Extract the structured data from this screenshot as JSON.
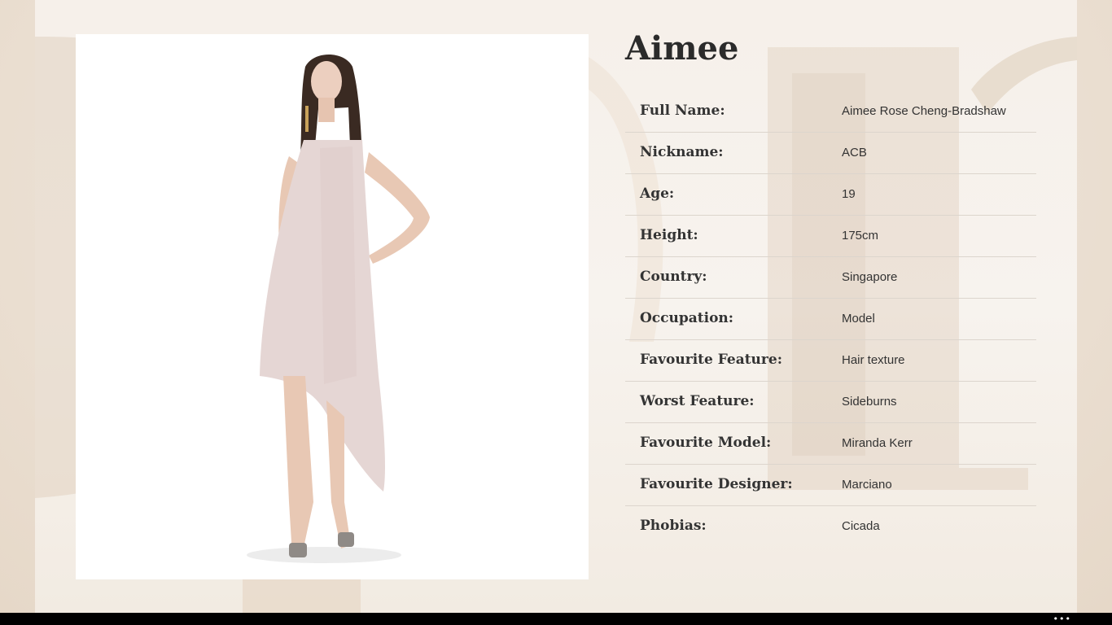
{
  "profile": {
    "name": "Aimee"
  },
  "details": [
    {
      "label": "Full Name:",
      "value": "Aimee Rose Cheng-Bradshaw"
    },
    {
      "label": "Nickname:",
      "value": "ACB"
    },
    {
      "label": "Age:",
      "value": "19"
    },
    {
      "label": "Height:",
      "value": "175cm"
    },
    {
      "label": "Country:",
      "value": "Singapore"
    },
    {
      "label": "Occupation:",
      "value": "Model"
    },
    {
      "label": "Favourite Feature:",
      "value": "Hair texture"
    },
    {
      "label": "Worst Feature:",
      "value": "Sideburns"
    },
    {
      "label": "Favourite Model:",
      "value": "Miranda Kerr"
    },
    {
      "label": "Favourite Designer:",
      "value": "Marciano"
    },
    {
      "label": "Phobias:",
      "value": "Cicada"
    }
  ],
  "taskbar": {
    "more_icon": "more-horizontal-icon"
  },
  "colors": {
    "page_background": "#f6f0ea",
    "text": "#333333",
    "divider": "#dcd5cd",
    "dress": "#e5d6d4"
  }
}
